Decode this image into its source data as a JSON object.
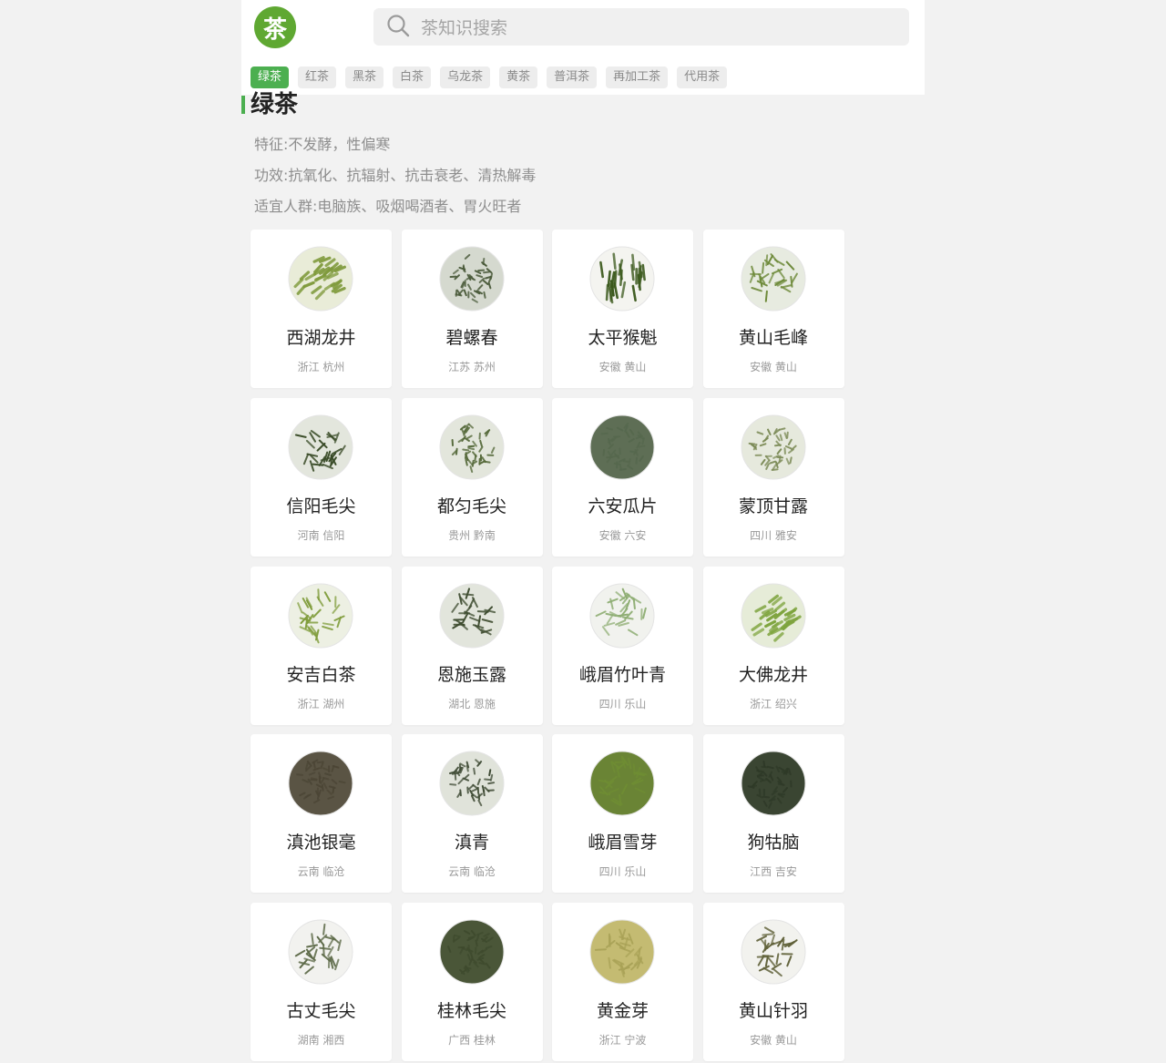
{
  "logo": {
    "glyph": "茶",
    "color": "#5fa832"
  },
  "search": {
    "placeholder": "茶知识搜索",
    "value": "",
    "icon": "search-icon"
  },
  "tabs": [
    {
      "label": "绿茶",
      "active": true
    },
    {
      "label": "红茶",
      "active": false
    },
    {
      "label": "黑茶",
      "active": false
    },
    {
      "label": "白茶",
      "active": false
    },
    {
      "label": "乌龙茶",
      "active": false
    },
    {
      "label": "黄茶",
      "active": false
    },
    {
      "label": "普洱茶",
      "active": false
    },
    {
      "label": "再加工茶",
      "active": false
    },
    {
      "label": "代用茶",
      "active": false
    }
  ],
  "accent": "#4caf50",
  "section": {
    "title": "绿茶",
    "traits": {
      "label": "特征:",
      "value": "不发酵，性偏寒"
    },
    "effects": {
      "label": "功效:",
      "value": "抗氧化、抗辐射、抗击衰老、清热解毒"
    },
    "audience": {
      "label": "适宜人群:",
      "value": "电脑族、吸烟喝酒者、胃火旺者"
    }
  },
  "teas": [
    {
      "name": "西湖龙井",
      "origin": "浙江 杭州",
      "leaf": "#7f9a3c",
      "bg": "#e9ecd8",
      "shape": "flat"
    },
    {
      "name": "碧螺春",
      "origin": "江苏 苏州",
      "leaf": "#4a5a3a",
      "bg": "#d5d9cf",
      "shape": "curl"
    },
    {
      "name": "太平猴魁",
      "origin": "安徽 黄山",
      "leaf": "#3c5a1e",
      "bg": "#f4f4f0",
      "shape": "long"
    },
    {
      "name": "黄山毛峰",
      "origin": "安徽 黄山",
      "leaf": "#6e8a3a",
      "bg": "#e7ebe0",
      "shape": "needle"
    },
    {
      "name": "信阳毛尖",
      "origin": "河南 信阳",
      "leaf": "#384a26",
      "bg": "#e3e6dd",
      "shape": "needle"
    },
    {
      "name": "都匀毛尖",
      "origin": "贵州 黔南",
      "leaf": "#55693a",
      "bg": "#e3e6dc",
      "shape": "curl"
    },
    {
      "name": "六安瓜片",
      "origin": "安徽 六安",
      "leaf": "#56684e",
      "bg": "#5e6e55",
      "shape": "curl"
    },
    {
      "name": "蒙顶甘露",
      "origin": "四川 雅安",
      "leaf": "#7b8a56",
      "bg": "#e6e9dd",
      "shape": "curl"
    },
    {
      "name": "安吉白茶",
      "origin": "浙江 湖州",
      "leaf": "#7f9c3a",
      "bg": "#edf0e3",
      "shape": "needle"
    },
    {
      "name": "恩施玉露",
      "origin": "湖北 恩施",
      "leaf": "#3e4c30",
      "bg": "#e2e5dc",
      "shape": "needle"
    },
    {
      "name": "峨眉竹叶青",
      "origin": "四川 乐山",
      "leaf": "#8fae74",
      "bg": "#f1f2ee",
      "shape": "needle"
    },
    {
      "name": "大佛龙井",
      "origin": "浙江 绍兴",
      "leaf": "#7ea43e",
      "bg": "#e6ecd8",
      "shape": "flat"
    },
    {
      "name": "滇池银毫",
      "origin": "云南 临沧",
      "leaf": "#4c4636",
      "bg": "#5a5444",
      "shape": "curl"
    },
    {
      "name": "滇青",
      "origin": "云南 临沧",
      "leaf": "#3e4a34",
      "bg": "#e0e3da",
      "shape": "curl"
    },
    {
      "name": "峨眉雪芽",
      "origin": "四川 乐山",
      "leaf": "#6f8d34",
      "bg": "#6a8435",
      "shape": "needle"
    },
    {
      "name": "狗牯脑",
      "origin": "江西 吉安",
      "leaf": "#2f3a28",
      "bg": "#3a4532",
      "shape": "curl"
    },
    {
      "name": "古丈毛尖",
      "origin": "湖南 湘西",
      "leaf": "#5d6a48",
      "bg": "#f2f2ef",
      "shape": "needle"
    },
    {
      "name": "桂林毛尖",
      "origin": "广西 桂林",
      "leaf": "#3f4b2e",
      "bg": "#4a5638",
      "shape": "curl"
    },
    {
      "name": "黄金芽",
      "origin": "浙江 宁波",
      "leaf": "#a9a257",
      "bg": "#c4bb72",
      "shape": "needle"
    },
    {
      "name": "黄山针羽",
      "origin": "安徽 黄山",
      "leaf": "#5f6038",
      "bg": "#f2f2ee",
      "shape": "needle"
    }
  ]
}
